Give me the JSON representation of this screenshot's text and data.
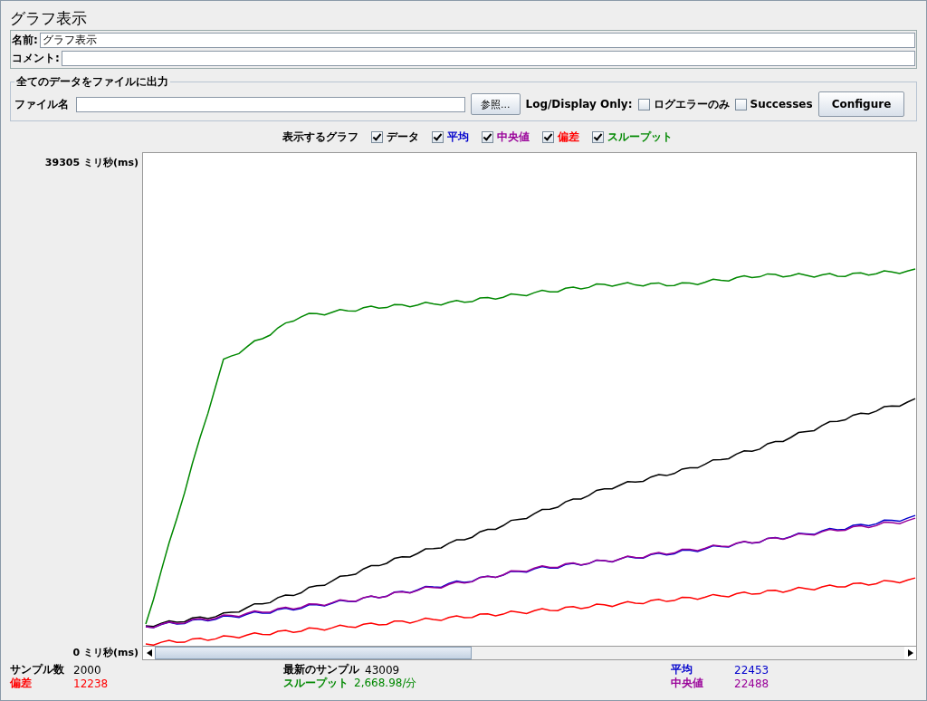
{
  "title": "グラフ表示",
  "name_field": {
    "label": "名前:",
    "value": "グラフ表示"
  },
  "comment_field": {
    "label": "コメント:"
  },
  "file_output": {
    "legend": "全てのデータをファイルに出力",
    "file_label": "ファイル名",
    "browse_button": "参照...",
    "log_display_label": "Log/Display Only:",
    "options": [
      {
        "label": "ログエラーのみ",
        "checked": false
      },
      {
        "label": "Successes",
        "checked": false
      }
    ],
    "configure_button": "Configure"
  },
  "graph_toggles": {
    "label": "表示するグラフ",
    "items": [
      {
        "label": "データ",
        "checked": true,
        "color": "#000000"
      },
      {
        "label": "平均",
        "checked": true,
        "color": "#0000cc"
      },
      {
        "label": "中央値",
        "checked": true,
        "color": "#990099"
      },
      {
        "label": "偏差",
        "checked": true,
        "color": "#ff0000"
      },
      {
        "label": "スループット",
        "checked": true,
        "color": "#008800"
      }
    ]
  },
  "y_axis": {
    "max_label": "39305 ミリ秒(ms)",
    "min_label": "0 ミリ秒(ms)"
  },
  "stats": [
    {
      "label": "サンプル数",
      "value": "2000",
      "color": "#000000"
    },
    {
      "label": "最新のサンプル",
      "value": "43009",
      "color": "#000000"
    },
    {
      "label": "平均",
      "value": "22453",
      "color": "#0000cc"
    },
    {
      "label": "偏差",
      "value": "12238",
      "color": "#ff0000"
    },
    {
      "label": "スループット",
      "value": "2,668.98/分",
      "color": "#008800"
    },
    {
      "label": "中央値",
      "value": "22488",
      "color": "#990099"
    }
  ]
}
